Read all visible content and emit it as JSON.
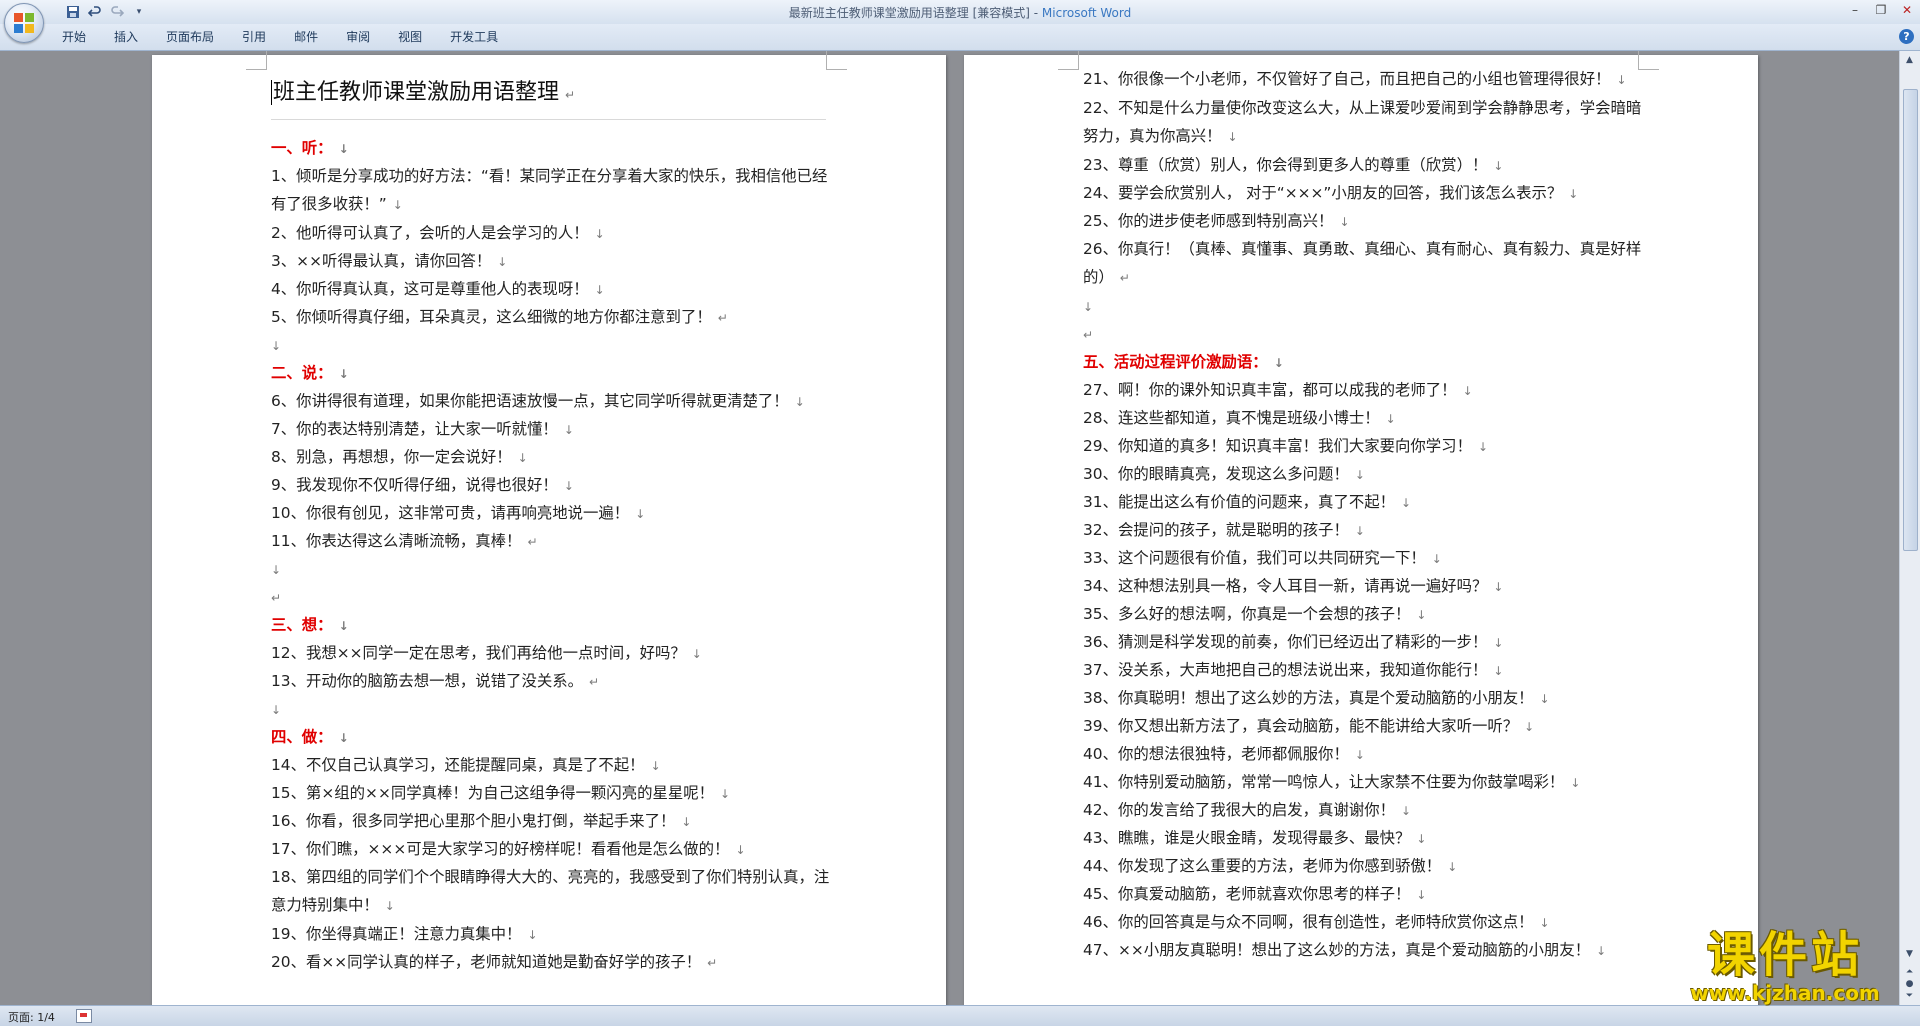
{
  "window": {
    "title": "最新班主任教师课堂激励用语整理 [兼容模式] - ",
    "brand": "Microsoft Word"
  },
  "qat": {
    "save_icon": "save-icon",
    "undo_icon": "undo-icon",
    "redo_icon": "redo-icon",
    "customize_icon": "customize-icon"
  },
  "ribbon_tabs": [
    "开始",
    "插入",
    "页面布局",
    "引用",
    "邮件",
    "审阅",
    "视图",
    "开发工具"
  ],
  "document": {
    "title": "班主任教师课堂激励用语整理",
    "page1": [
      {
        "t": "head",
        "text": "一、听：",
        "mark": "↓"
      },
      {
        "t": "wrap",
        "text": "1、倾听是分享成功的好方法：“看！某同学正在分享着大家的快乐，我相信他已经有了很多收获！”",
        "mark": "↓"
      },
      {
        "t": "line",
        "text": "2、他听得可认真了，会听的人是会学习的人！",
        "mark": "↓"
      },
      {
        "t": "line",
        "text": "3、××听得最认真，请你回答！",
        "mark": "↓"
      },
      {
        "t": "line",
        "text": "4、你听得真认真，这可是尊重他人的表现呀！",
        "mark": "↓"
      },
      {
        "t": "line",
        "text": "5、你倾听得真仔细，耳朵真灵，这么细微的地方你都注意到了！",
        "mark": "↵"
      },
      {
        "t": "blank",
        "text": "",
        "mark": "↓"
      },
      {
        "t": "head",
        "text": "二、说：",
        "mark": "↓"
      },
      {
        "t": "line",
        "text": "6、你讲得很有道理，如果你能把语速放慢一点，其它同学听得就更清楚了！",
        "mark": "↓"
      },
      {
        "t": "line",
        "text": "7、你的表达特别清楚，让大家一听就懂！",
        "mark": "↓"
      },
      {
        "t": "line",
        "text": "8、别急，再想想，你一定会说好！",
        "mark": "↓"
      },
      {
        "t": "line",
        "text": "9、我发现你不仅听得仔细，说得也很好！",
        "mark": "↓"
      },
      {
        "t": "line",
        "text": "10、你很有创见，这非常可贵，请再响亮地说一遍！",
        "mark": "↓"
      },
      {
        "t": "line",
        "text": "11、你表达得这么清晰流畅，真棒！",
        "mark": "↵"
      },
      {
        "t": "blank",
        "text": "",
        "mark": "↓"
      },
      {
        "t": "blank",
        "text": "",
        "mark": "↵"
      },
      {
        "t": "head",
        "text": "三、想：",
        "mark": "↓"
      },
      {
        "t": "line",
        "text": "12、我想××同学一定在思考，我们再给他一点时间，好吗？",
        "mark": "↓"
      },
      {
        "t": "line",
        "text": "13、开动你的脑筋去想一想，说错了没关系。",
        "mark": "↵"
      },
      {
        "t": "blank",
        "text": "",
        "mark": "↓"
      },
      {
        "t": "head",
        "text": "四、做：",
        "mark": "↓"
      },
      {
        "t": "line",
        "text": "14、不仅自己认真学习，还能提醒同桌，真是了不起！",
        "mark": "↓"
      },
      {
        "t": "line",
        "text": "15、第×组的××同学真棒！为自己这组争得一颗闪亮的星星呢！",
        "mark": "↓"
      },
      {
        "t": "line",
        "text": "16、你看，很多同学把心里那个胆小鬼打倒，举起手来了！",
        "mark": "↓"
      },
      {
        "t": "line",
        "text": "17、你们瞧，×××可是大家学习的好榜样呢！看看他是怎么做的！",
        "mark": "↓"
      },
      {
        "t": "wrap",
        "text": "18、第四组的同学们个个眼睛睁得大大的、亮亮的，我感受到了你们特别认真，注意力特别集中！",
        "mark": "↓"
      },
      {
        "t": "line",
        "text": "19、你坐得真端正！注意力真集中！",
        "mark": "↓"
      },
      {
        "t": "line",
        "text": "20、看××同学认真的样子，老师就知道她是勤奋好学的孩子！",
        "mark": "↵"
      }
    ],
    "page2": [
      {
        "t": "wrap",
        "text": "21、你很像一个小老师，不仅管好了自己，而且把自己的小组也管理得很好！",
        "mark": "↓"
      },
      {
        "t": "wrap",
        "text": "22、不知是什么力量使你改变这么大，从上课爱吵爱闹到学会静静思考，学会暗暗努力，真为你高兴！",
        "mark": "↓"
      },
      {
        "t": "line",
        "text": "23、尊重（欣赏）别人，你会得到更多人的尊重（欣赏）！",
        "mark": "↓"
      },
      {
        "t": "line",
        "text": "24、要学会欣赏别人， 对于“×××”小朋友的回答，我们该怎么表示？",
        "mark": "↓"
      },
      {
        "t": "line",
        "text": "25、你的进步使老师感到特别高兴！",
        "mark": "↓"
      },
      {
        "t": "wrap",
        "text": "26、你真行！（真棒、真懂事、真勇敢、真细心、真有耐心、真有毅力、真是好样的）",
        "mark": "↵"
      },
      {
        "t": "blank",
        "text": "",
        "mark": "↓"
      },
      {
        "t": "blank",
        "text": "",
        "mark": "↵"
      },
      {
        "t": "head",
        "text": "五、活动过程评价激励语：",
        "mark": "↓"
      },
      {
        "t": "line",
        "text": "27、啊！你的课外知识真丰富，都可以成我的老师了！",
        "mark": "↓"
      },
      {
        "t": "line",
        "text": "28、连这些都知道，真不愧是班级小博士！",
        "mark": "↓"
      },
      {
        "t": "line",
        "text": "29、你知道的真多！知识真丰富！我们大家要向你学习！",
        "mark": "↓"
      },
      {
        "t": "line",
        "text": "30、你的眼睛真亮，发现这么多问题！",
        "mark": "↓"
      },
      {
        "t": "line",
        "text": "31、能提出这么有价值的问题来，真了不起！",
        "mark": "↓"
      },
      {
        "t": "line",
        "text": "32、会提问的孩子，就是聪明的孩子！",
        "mark": "↓"
      },
      {
        "t": "line",
        "text": "33、这个问题很有价值，我们可以共同研究一下！",
        "mark": "↓"
      },
      {
        "t": "line",
        "text": "34、这种想法别具一格，令人耳目一新，请再说一遍好吗？",
        "mark": "↓"
      },
      {
        "t": "line",
        "text": "35、多么好的想法啊，你真是一个会想的孩子！",
        "mark": "↓"
      },
      {
        "t": "line",
        "text": "36、猜测是科学发现的前奏，你们已经迈出了精彩的一步！",
        "mark": "↓"
      },
      {
        "t": "line",
        "text": "37、没关系，大声地把自己的想法说出来，我知道你能行！",
        "mark": "↓"
      },
      {
        "t": "line",
        "text": "38、你真聪明！想出了这么妙的方法，真是个爱动脑筋的小朋友！",
        "mark": "↓"
      },
      {
        "t": "line",
        "text": "39、你又想出新方法了，真会动脑筋，能不能讲给大家听一听？",
        "mark": "↓"
      },
      {
        "t": "line",
        "text": "40、你的想法很独特，老师都佩服你！",
        "mark": "↓"
      },
      {
        "t": "line",
        "text": "41、你特别爱动脑筋，常常一鸣惊人，让大家禁不住要为你鼓掌喝彩！",
        "mark": "↓"
      },
      {
        "t": "line",
        "text": "42、你的发言给了我很大的启发，真谢谢你！",
        "mark": "↓"
      },
      {
        "t": "line",
        "text": "43、瞧瞧，谁是火眼金睛，发现得最多、最快？",
        "mark": "↓"
      },
      {
        "t": "line",
        "text": "44、你发现了这么重要的方法，老师为你感到骄傲！",
        "mark": "↓"
      },
      {
        "t": "line",
        "text": "45、你真爱动脑筋，老师就喜欢你思考的样子！",
        "mark": "↓"
      },
      {
        "t": "line",
        "text": "46、你的回答真是与众不同啊，很有创造性，老师特欣赏你这点！",
        "mark": "↓"
      },
      {
        "t": "line",
        "text": "47、××小朋友真聪明！想出了这么妙的方法，真是个爱动脑筋的小朋友！",
        "mark": "↓"
      }
    ]
  },
  "status": {
    "page": "页面: 1/4"
  },
  "watermark": {
    "main": "课件站",
    "url": "www.kjzhan.com"
  },
  "colors": {
    "heading": "#e00000",
    "watermark": "#f2d400",
    "brand": "#3a78c2"
  }
}
